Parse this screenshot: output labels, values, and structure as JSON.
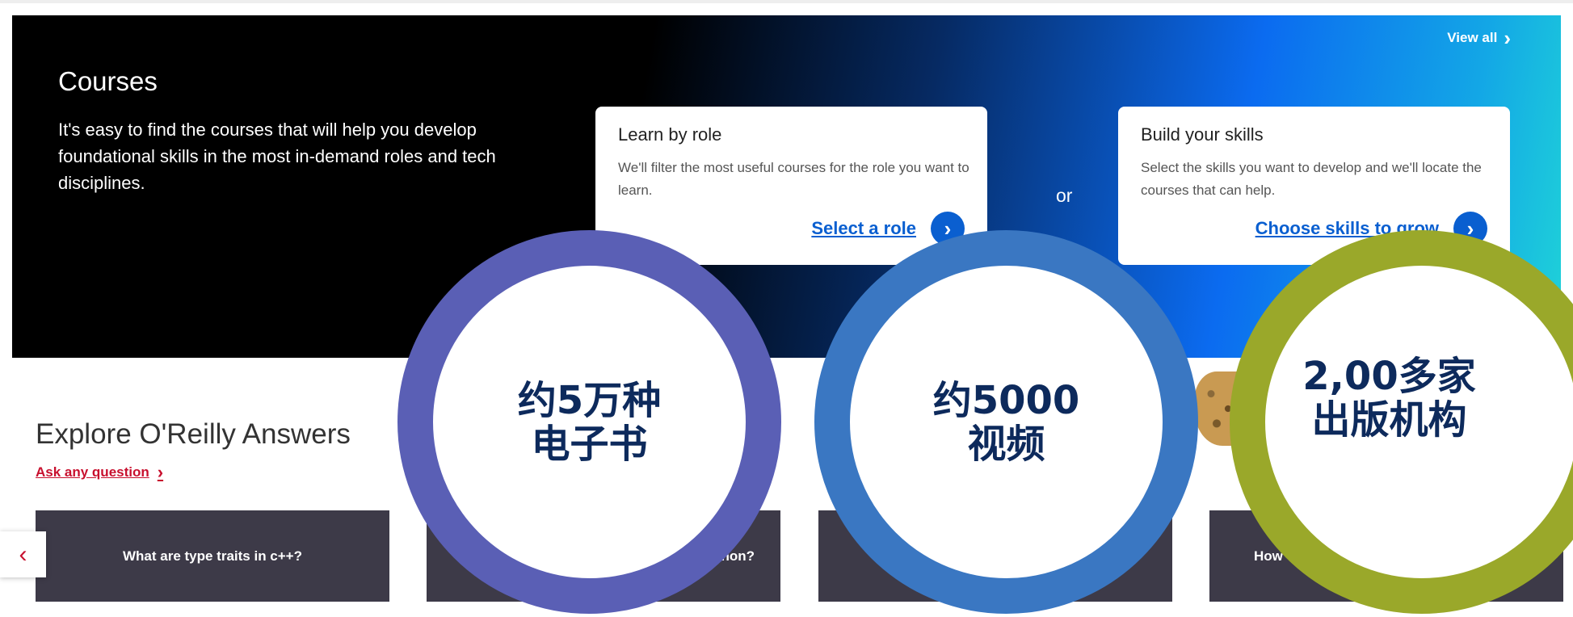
{
  "hero": {
    "title": "Courses",
    "description": "It's easy to find the courses that will help you develop foundational skills in the most in-demand roles and tech disciplines.",
    "view_all": "View all",
    "or_text": "or",
    "cards": [
      {
        "title": "Learn by role",
        "description": "We'll filter the most useful courses for the role you want to learn.",
        "cta": "Select a role"
      },
      {
        "title": "Build your skills",
        "description": "Select the skills you want to develop and we'll locate the courses that can help.",
        "cta": "Choose skills to grow"
      }
    ]
  },
  "explore": {
    "title": "Explore O'Reilly Answers",
    "ask_link": "Ask any question",
    "questions": [
      "What are type traits in c++?",
      "non?",
      "",
      "How"
    ]
  },
  "stats": [
    {
      "text": "约5万种\n电子书",
      "color": "#5a5fb5"
    },
    {
      "text": "约5000\n视频",
      "color": "#3a77c2"
    },
    {
      "text": "2,00多家\n出版机构",
      "color": "#9aa82a"
    }
  ],
  "icons": {
    "chevron": "chevron-right-icon",
    "prev": "chevron-left-icon"
  },
  "colors": {
    "brand_red": "#c8102e",
    "cta_blue": "#0a5fd0",
    "question_card": "#3d3a48"
  }
}
